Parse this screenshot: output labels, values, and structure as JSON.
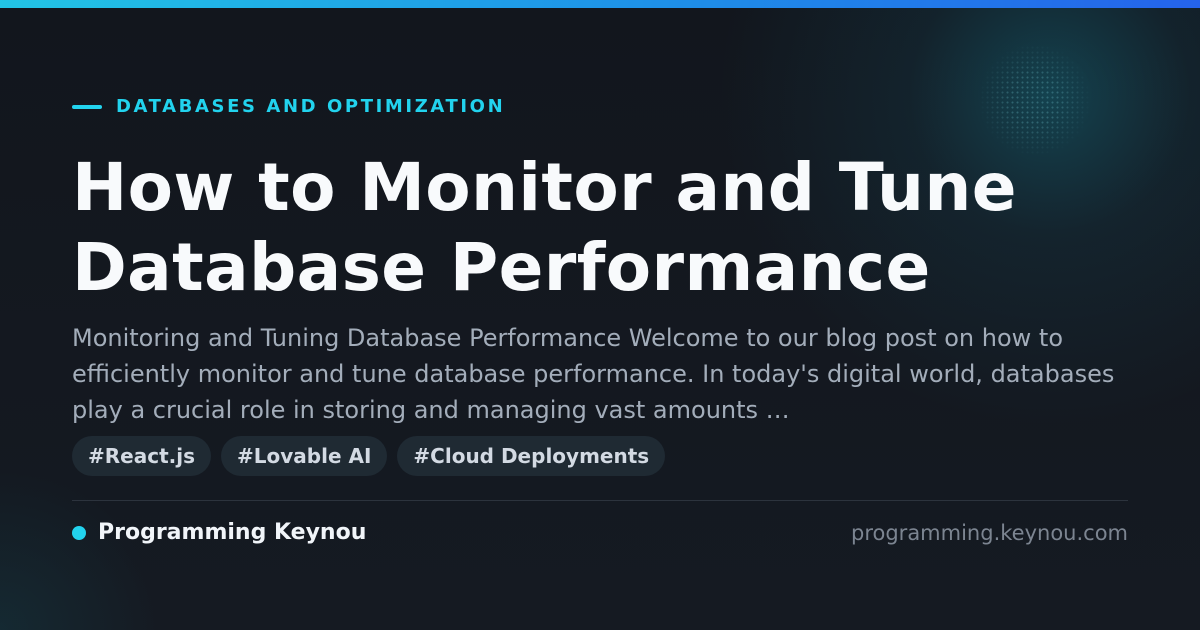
{
  "header": {
    "category": "DATABASES AND OPTIMIZATION",
    "title": "How to Monitor and Tune Database Performance"
  },
  "excerpt": "Monitoring and Tuning Database Performance Welcome to our blog post on how to efficiently monitor and tune database performance. In today's digital world, databases play a crucial role in storing and managing vast amounts …",
  "tags": [
    "#React.js",
    "#Lovable AI",
    "#Cloud Deployments"
  ],
  "footer": {
    "brand": "Programming Keynou",
    "domain": "programming.keynou.com"
  },
  "colors": {
    "accent": "#22d3ee",
    "background": "#13171f",
    "title": "#f8fafc",
    "excerpt": "#a3adba",
    "tag_background": "#1f2a33"
  }
}
